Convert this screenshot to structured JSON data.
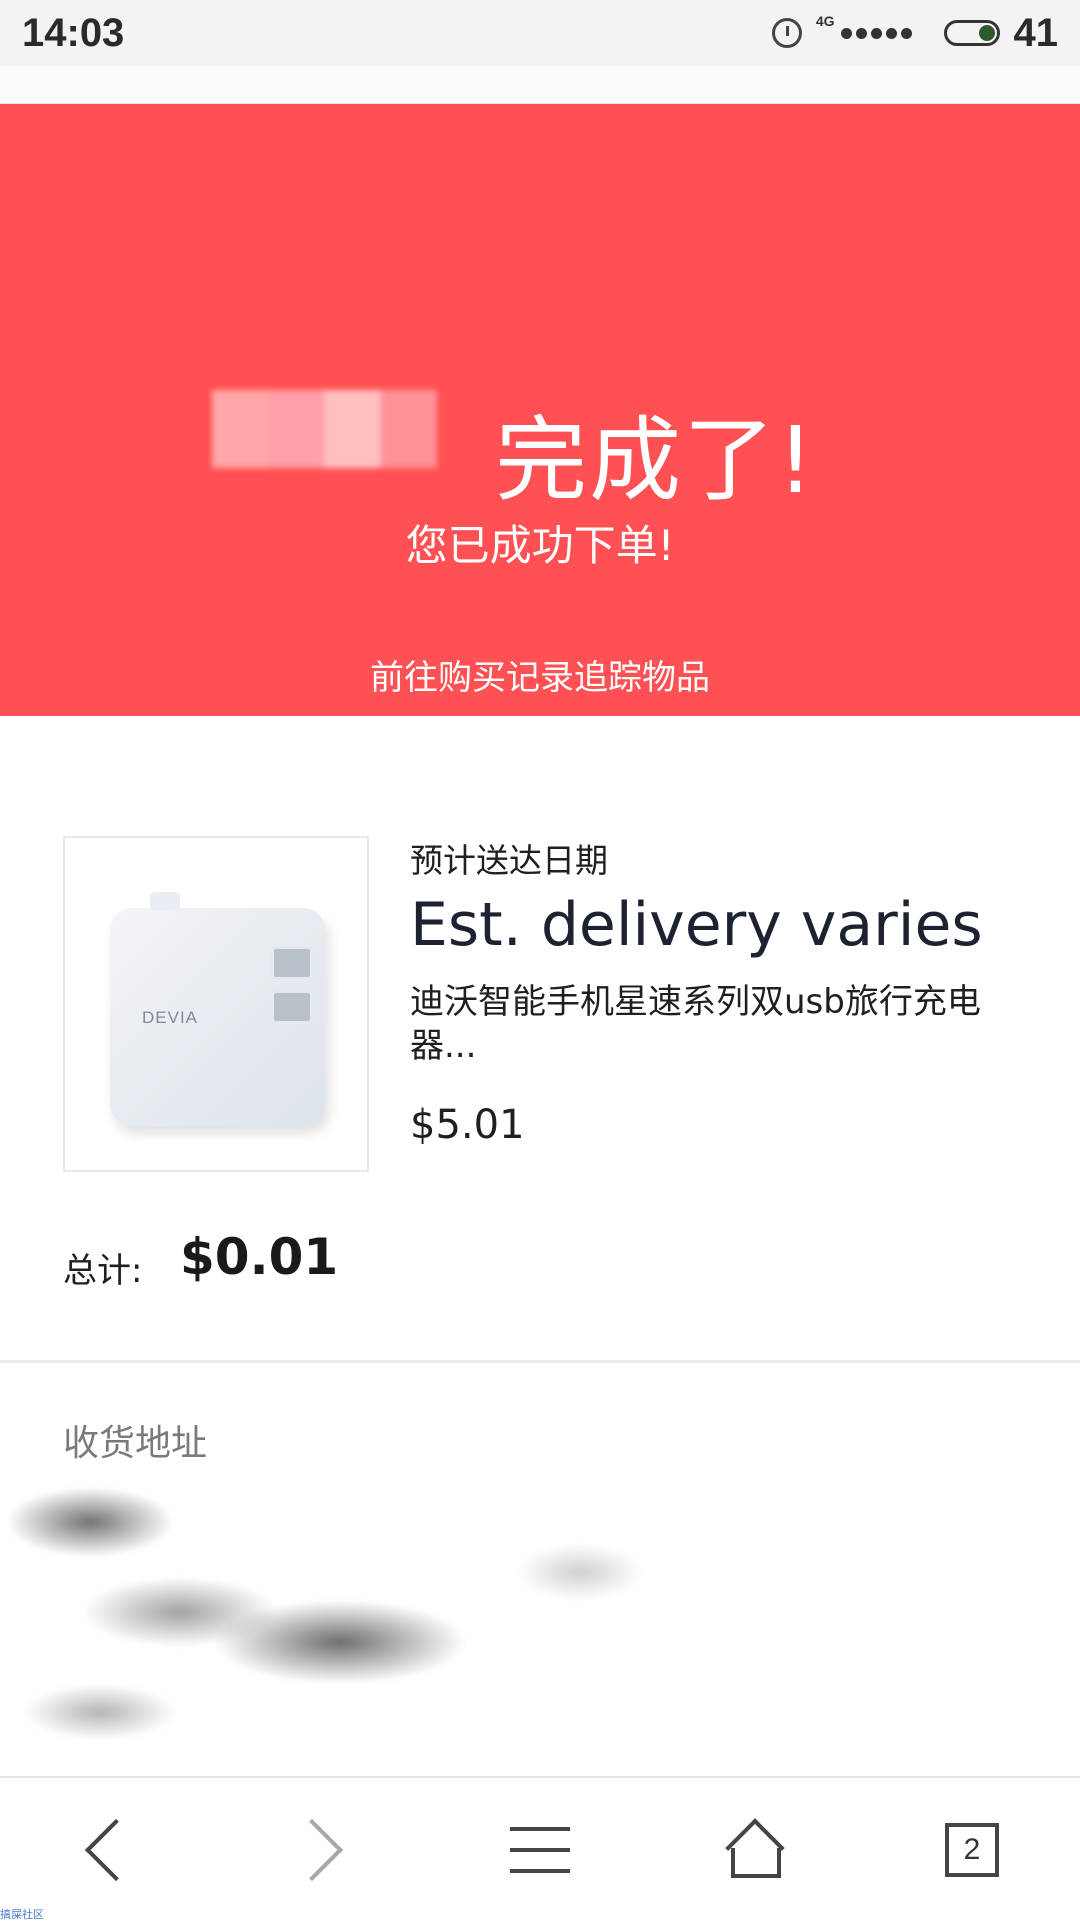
{
  "status_bar": {
    "time": "14:03",
    "network": "4G",
    "battery": "41"
  },
  "banner": {
    "title": "完成了!",
    "subtitle": "您已成功下单!",
    "track_link": "前往购买记录追踪物品",
    "background_color": "#ff5153"
  },
  "order": {
    "eta_label": "预计送达日期",
    "eta_value": "Est. delivery varies",
    "product_name": "迪沃智能手机星速系列双usb旅行充电器...",
    "product_price": "$5.01",
    "product_brand": "DEVIA",
    "total_label": "总计:",
    "total_value": "$0.01"
  },
  "address": {
    "title": "收货地址"
  },
  "bottom_nav": {
    "tab_count": "2",
    "icons": [
      "back-icon",
      "forward-icon",
      "menu-icon",
      "home-icon",
      "tabs-icon"
    ]
  },
  "watermark": "搞屎社区"
}
